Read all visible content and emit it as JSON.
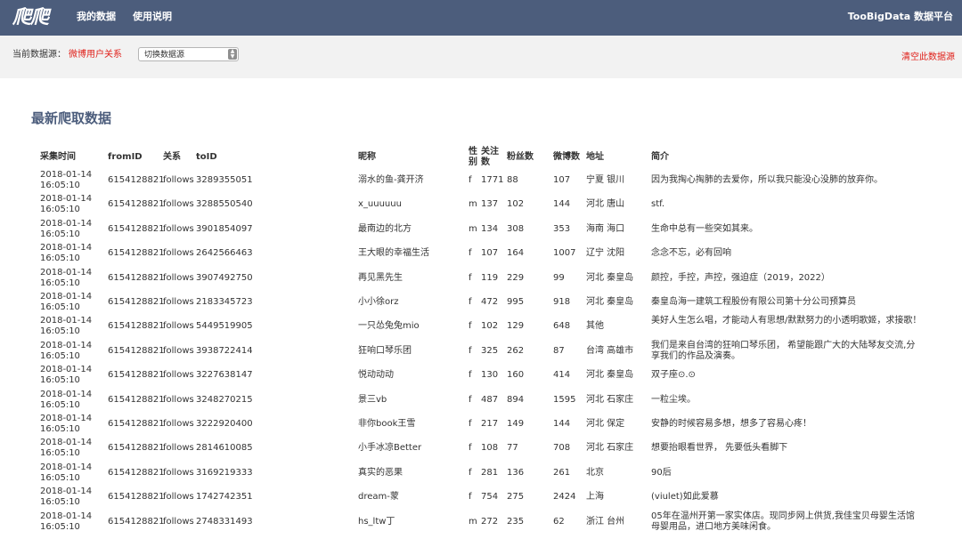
{
  "header": {
    "logo": "爬爬",
    "nav": [
      "我的数据",
      "使用说明"
    ],
    "brand": "TooBigData 数据平台"
  },
  "source_bar": {
    "label": "当前数据源：",
    "current": "微博用户关系",
    "switch_select": "切换数据源",
    "clear_link": "清空此数据源"
  },
  "main": {
    "title": "最新爬取数据",
    "columns": {
      "time": "采集时间",
      "from": "fromID",
      "relation": "关系",
      "to": "toID",
      "nickname": "昵称",
      "sex": "性别",
      "follow": "关注数",
      "fans": "粉丝数",
      "weibo": "微博数",
      "address": "地址",
      "intro": "简介"
    },
    "rows": [
      {
        "time": "2018-01-14 16:05:10",
        "from": "6154128821",
        "relation": "follows",
        "to": "3289355051",
        "nickname": "溺水的鱼-龚开济",
        "sex": "f",
        "follow": "1771",
        "fans": "88",
        "weibo": "107",
        "address": "宁夏 银川",
        "intro": "因为我掏心掏肺的去爱你，所以我只能没心没肺的放弃你。"
      },
      {
        "time": "2018-01-14 16:05:10",
        "from": "6154128821",
        "relation": "follows",
        "to": "3288550540",
        "nickname": "x_uuuuuu",
        "sex": "m",
        "follow": "137",
        "fans": "102",
        "weibo": "144",
        "address": "河北 唐山",
        "intro": "stf."
      },
      {
        "time": "2018-01-14 16:05:10",
        "from": "6154128821",
        "relation": "follows",
        "to": "3901854097",
        "nickname": "最南边的北方",
        "sex": "m",
        "follow": "134",
        "fans": "308",
        "weibo": "353",
        "address": "海南 海口",
        "intro": "生命中总有一些突如其来。"
      },
      {
        "time": "2018-01-14 16:05:10",
        "from": "6154128821",
        "relation": "follows",
        "to": "2642566463",
        "nickname": "王大眼的幸福生活",
        "sex": "f",
        "follow": "107",
        "fans": "164",
        "weibo": "1007",
        "address": "辽宁 沈阳",
        "intro": "念念不忘，必有回响"
      },
      {
        "time": "2018-01-14 16:05:10",
        "from": "6154128821",
        "relation": "follows",
        "to": "3907492750",
        "nickname": "再见黑先生",
        "sex": "f",
        "follow": "119",
        "fans": "229",
        "weibo": "99",
        "address": "河北 秦皇岛",
        "intro": "颜控，手控，声控，强迫症（2019，2022）"
      },
      {
        "time": "2018-01-14 16:05:10",
        "from": "6154128821",
        "relation": "follows",
        "to": "2183345723",
        "nickname": "小小徐orz",
        "sex": "f",
        "follow": "472",
        "fans": "995",
        "weibo": "918",
        "address": "河北 秦皇岛",
        "intro": "秦皇岛海一建筑工程股份有限公司第十分公司预算员"
      },
      {
        "time": "2018-01-14 16:05:10",
        "from": "6154128821",
        "relation": "follows",
        "to": "5449519905",
        "nickname": "一只怂兔兔mio",
        "sex": "f",
        "follow": "102",
        "fans": "129",
        "weibo": "648",
        "address": "其他",
        "intro": "美好人生怎么唱，才能动人有思想/默默努力的小透明歌姬，求接歌！"
      },
      {
        "time": "2018-01-14 16:05:10",
        "from": "6154128821",
        "relation": "follows",
        "to": "3938722414",
        "nickname": "狂响口琴乐团",
        "sex": "f",
        "follow": "325",
        "fans": "262",
        "weibo": "87",
        "address": "台湾 高雄市",
        "intro": "我们是来自台湾的狂响口琴乐团， 希望能跟广大的大陆琴友交流,分享我们的作品及演奏。"
      },
      {
        "time": "2018-01-14 16:05:10",
        "from": "6154128821",
        "relation": "follows",
        "to": "3227638147",
        "nickname": "悦动动动",
        "sex": "f",
        "follow": "130",
        "fans": "160",
        "weibo": "414",
        "address": "河北 秦皇岛",
        "intro": "双子座⊙.⊙"
      },
      {
        "time": "2018-01-14 16:05:10",
        "from": "6154128821",
        "relation": "follows",
        "to": "3248270215",
        "nickname": "景三vb",
        "sex": "f",
        "follow": "487",
        "fans": "894",
        "weibo": "1595",
        "address": "河北 石家庄",
        "intro": "一粒尘埃。"
      },
      {
        "time": "2018-01-14 16:05:10",
        "from": "6154128821",
        "relation": "follows",
        "to": "3222920400",
        "nickname": "非你book王雪",
        "sex": "f",
        "follow": "217",
        "fans": "149",
        "weibo": "144",
        "address": "河北 保定",
        "intro": "安静的时候容易多想，想多了容易心疼！"
      },
      {
        "time": "2018-01-14 16:05:10",
        "from": "6154128821",
        "relation": "follows",
        "to": "2814610085",
        "nickname": "小手冰凉Better",
        "sex": "f",
        "follow": "108",
        "fans": "77",
        "weibo": "708",
        "address": "河北 石家庄",
        "intro": "想要抬眼看世界， 先要低头看脚下"
      },
      {
        "time": "2018-01-14 16:05:10",
        "from": "6154128821",
        "relation": "follows",
        "to": "3169219333",
        "nickname": "真实的恶果",
        "sex": "f",
        "follow": "281",
        "fans": "136",
        "weibo": "261",
        "address": "北京",
        "intro": "90后"
      },
      {
        "time": "2018-01-14 16:05:10",
        "from": "6154128821",
        "relation": "follows",
        "to": "1742742351",
        "nickname": "dream-蒙",
        "sex": "f",
        "follow": "754",
        "fans": "275",
        "weibo": "2424",
        "address": "上海",
        "intro": "(viulet)如此爱慕"
      },
      {
        "time": "2018-01-14 16:05:10",
        "from": "6154128821",
        "relation": "follows",
        "to": "2748331493",
        "nickname": "hs_ltw丁",
        "sex": "m",
        "follow": "272",
        "fans": "235",
        "weibo": "62",
        "address": "浙江 台州",
        "intro": "05年在温州开第一家实体店。现同步网上供货,我佳宝贝母婴生活馆母婴用品，进口地方美味闲食。"
      }
    ]
  }
}
